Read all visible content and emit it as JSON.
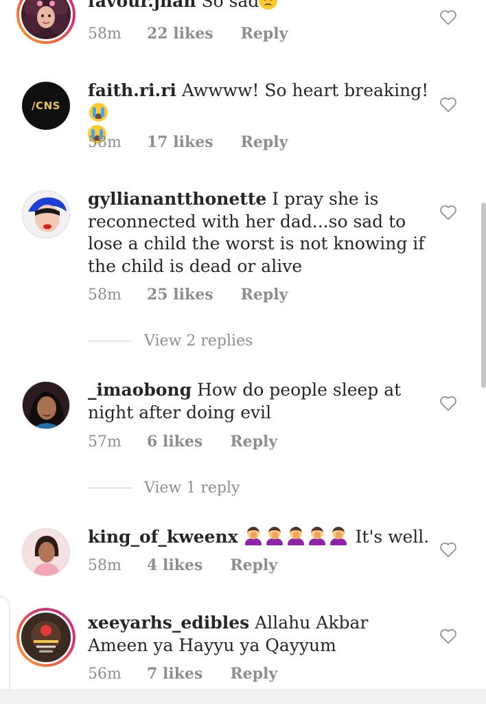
{
  "comments": [
    {
      "username": "favour.jhan",
      "text": "So sad",
      "emoji": "sad-face",
      "time": "58m",
      "likes": "22 likes",
      "reply": "Reply"
    },
    {
      "username": "faith.ri.ri",
      "text": "Awwww! So heart breaking!",
      "emoji": "crying-face",
      "avatar_text": "/CNS",
      "time": "58m",
      "likes": "17 likes",
      "reply": "Reply"
    },
    {
      "username": "gyllianantthonette",
      "text": "I pray she is reconnected with her dad...so sad to lose a child the worst is not knowing if the child is dead or alive",
      "time": "58m",
      "likes": "25 likes",
      "reply": "Reply",
      "view_replies": "View 2 replies"
    },
    {
      "username": "_imaobong",
      "text": "How do people sleep at night after doing evil",
      "time": "57m",
      "likes": "6 likes",
      "reply": "Reply",
      "view_replies": "View 1 reply"
    },
    {
      "username": "king_of_kweenx",
      "text": "It's well.",
      "emoji": "woman-facepalming",
      "time": "58m",
      "likes": "4 likes",
      "reply": "Reply"
    },
    {
      "username": "xeeyarhs_edibles",
      "text": "Allahu Akbar Ameen ya Hayyu ya Qayyum",
      "time": "56m",
      "likes": "7 likes",
      "reply": "Reply"
    }
  ],
  "colors": {
    "text": "#262626",
    "meta": "#8e8e8e",
    "story_ring": "#e1306c"
  },
  "icons": [
    "heart-outline-icon",
    "crying-face-emoji",
    "sad-face-emoji",
    "woman-facepalming-emoji"
  ]
}
